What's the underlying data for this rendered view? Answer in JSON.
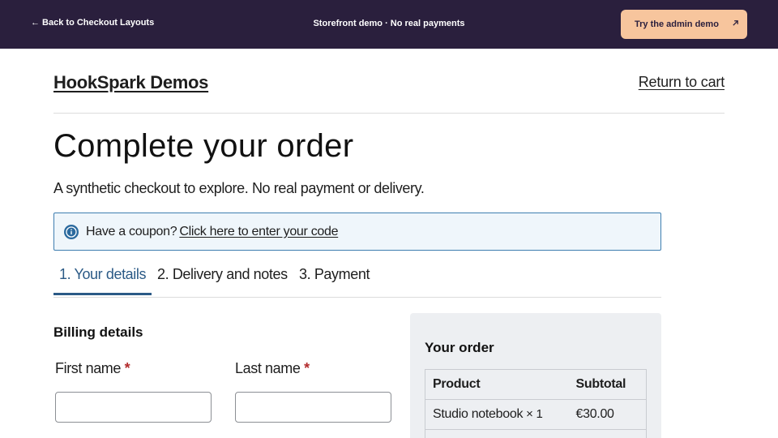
{
  "topbar": {
    "back_label": "← Back to Checkout Layouts",
    "demo_note": "Storefront demo · No real payments",
    "admin_button_label": "Try the admin demo",
    "admin_button_icon": "arrow-up-right-icon"
  },
  "header": {
    "site_title": "HookSpark Demos",
    "return_link": "Return to cart"
  },
  "page": {
    "title": "Complete your order",
    "subtitle": "A synthetic checkout to explore. No real payment or delivery."
  },
  "coupon": {
    "icon": "info-icon",
    "text": "Have a coupon?",
    "link": "Click here to enter your code"
  },
  "steps": [
    {
      "label": "1. Your details",
      "active": true
    },
    {
      "label": "2. Delivery and notes",
      "active": false
    },
    {
      "label": "3. Payment",
      "active": false
    }
  ],
  "billing": {
    "title": "Billing details",
    "first_name_label": "First name",
    "last_name_label": "Last name",
    "required_mark": "*",
    "first_name_value": "",
    "last_name_value": ""
  },
  "order": {
    "title": "Your order",
    "columns": [
      "Product",
      "Subtotal"
    ],
    "rows": [
      {
        "product": "Studio notebook",
        "qty": "× 1",
        "subtotal": "€30.00"
      }
    ]
  },
  "colors": {
    "topbar_bg": "#2a1f3d",
    "admin_button_bg": "#f7c59d",
    "active_step": "#2b5a86",
    "required": "#b32d2e",
    "info_blue": "#2b6a9e"
  }
}
